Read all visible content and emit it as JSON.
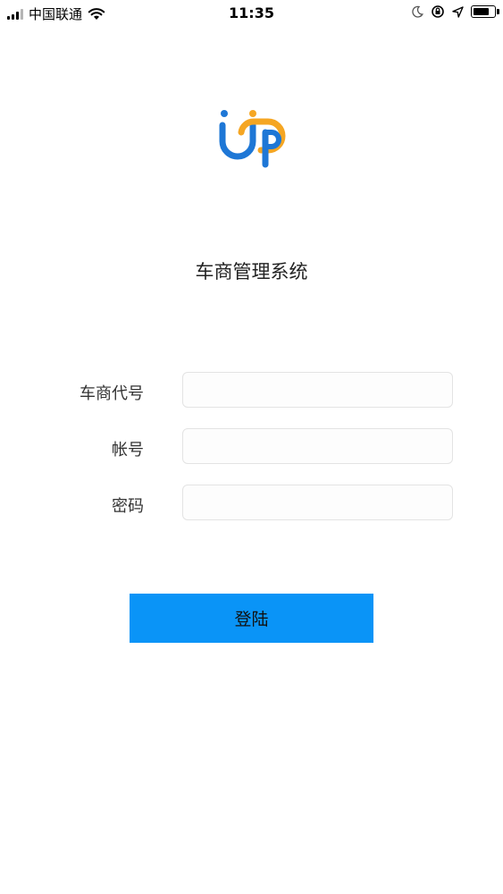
{
  "status_bar": {
    "carrier": "中国联通",
    "time": "11:35",
    "battery_level": 0.85
  },
  "app": {
    "title": "车商管理系统",
    "logo_colors": {
      "blue": "#1e77d6",
      "orange": "#f5a623"
    }
  },
  "form": {
    "dealer_code_label": "车商代号",
    "dealer_code_value": "",
    "account_label": "帐号",
    "account_value": "",
    "password_label": "密码",
    "password_value": ""
  },
  "actions": {
    "login_label": "登陆",
    "login_color": "#0a94f7"
  }
}
